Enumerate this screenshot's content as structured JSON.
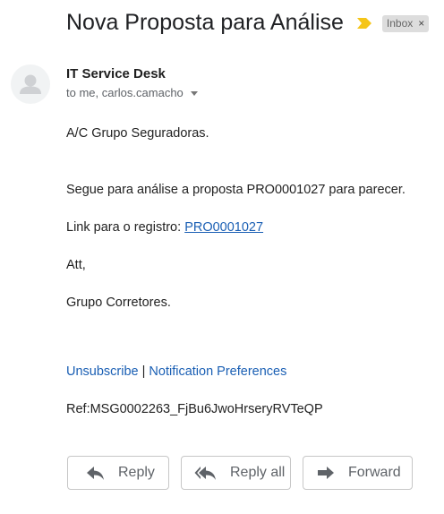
{
  "email": {
    "subject": "Nova Proposta para Análise",
    "label": "Inbox",
    "label_close": "×",
    "sender": "IT Service Desk",
    "recipients": "to me, carlos.camacho"
  },
  "body": {
    "greeting": "A/C Grupo Seguradoras.",
    "intro": "Segue para análise a proposta PRO0001027 para parecer.",
    "link_prefix": "Link para o registro: ",
    "link_text": "PRO0001027",
    "closing": "Att,",
    "signature": "Grupo Corretores.",
    "unsubscribe": "Unsubscribe",
    "separator": " | ",
    "preferences": "Notification Preferences",
    "ref": "Ref:MSG0002263_FjBu6JwoHrseryRVTeQP"
  },
  "actions": {
    "reply": "Reply",
    "reply_all": "Reply all",
    "forward": "Forward"
  },
  "colors": {
    "importance": "#f5c518",
    "link": "#1a5fb4",
    "chip_bg": "#dddddd"
  },
  "icons": {
    "importance": "importance-marker-icon",
    "avatar": "person-icon",
    "reply": "reply-arrow-icon",
    "reply_all": "reply-all-arrow-icon",
    "forward": "forward-arrow-icon"
  }
}
